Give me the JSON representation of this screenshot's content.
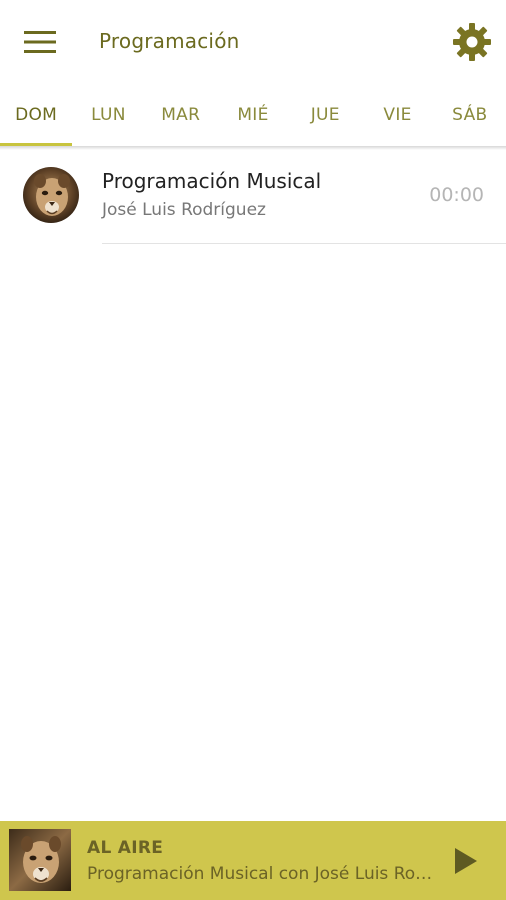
{
  "header": {
    "title": "Programación",
    "menu_icon": "hamburger-menu-icon",
    "settings_icon": "gear-icon"
  },
  "tabs": [
    {
      "label": "DOM",
      "active": true
    },
    {
      "label": "LUN",
      "active": false
    },
    {
      "label": "MAR",
      "active": false
    },
    {
      "label": "MIÉ",
      "active": false
    },
    {
      "label": "JUE",
      "active": false
    },
    {
      "label": "VIE",
      "active": false
    },
    {
      "label": "SÁB",
      "active": false
    }
  ],
  "schedule": [
    {
      "title": "Programación Musical",
      "host": "José Luis Rodríguez",
      "time": "00:00",
      "avatar": "puma-photo"
    }
  ],
  "player": {
    "label": "AL AIRE",
    "now_playing": "Programación Musical con José Luis Rodríguez",
    "play_icon": "play-icon",
    "thumbnail": "puma-photo"
  },
  "colors": {
    "accent": "#c8c43e",
    "text_accent": "#6b6a1f",
    "player_bg": "#cfc64d",
    "player_text": "#6b6326"
  }
}
